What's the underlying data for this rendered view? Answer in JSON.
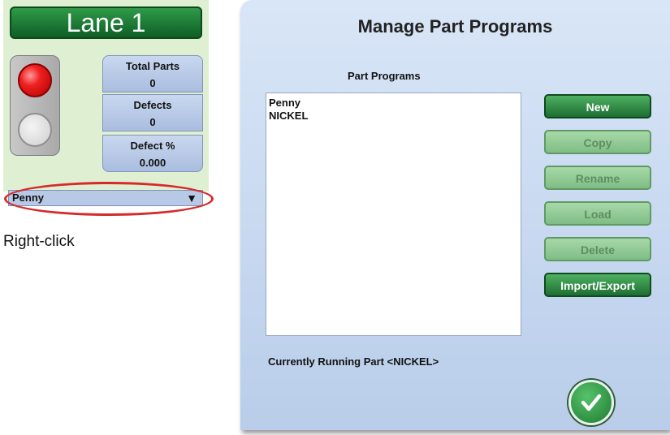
{
  "lane": {
    "title": "Lane 1",
    "stats": [
      {
        "label": "Total Parts",
        "value": "0"
      },
      {
        "label": "Defects",
        "value": "0"
      },
      {
        "label": "Defect %",
        "value": "0.000"
      }
    ],
    "selected_part": "Penny",
    "dropdown_arrow": "▼",
    "light_colors": {
      "active": "#ef2020",
      "inactive": "#cfcfcf"
    }
  },
  "caption": "Right-click",
  "dialog": {
    "title": "Manage Part Programs",
    "list_label": "Part Programs",
    "programs": [
      "Penny",
      "NICKEL"
    ],
    "buttons": [
      {
        "label": "New",
        "enabled": true
      },
      {
        "label": "Copy",
        "enabled": false
      },
      {
        "label": "Rename",
        "enabled": false
      },
      {
        "label": "Load",
        "enabled": false
      },
      {
        "label": "Delete",
        "enabled": false
      },
      {
        "label": "Import/Export",
        "enabled": true
      }
    ],
    "status": "Currently Running Part <NICKEL>",
    "ok_icon": "checkmark-icon"
  },
  "colors": {
    "highlight": "#d42a2a",
    "accent_green": "#1d6e31"
  }
}
